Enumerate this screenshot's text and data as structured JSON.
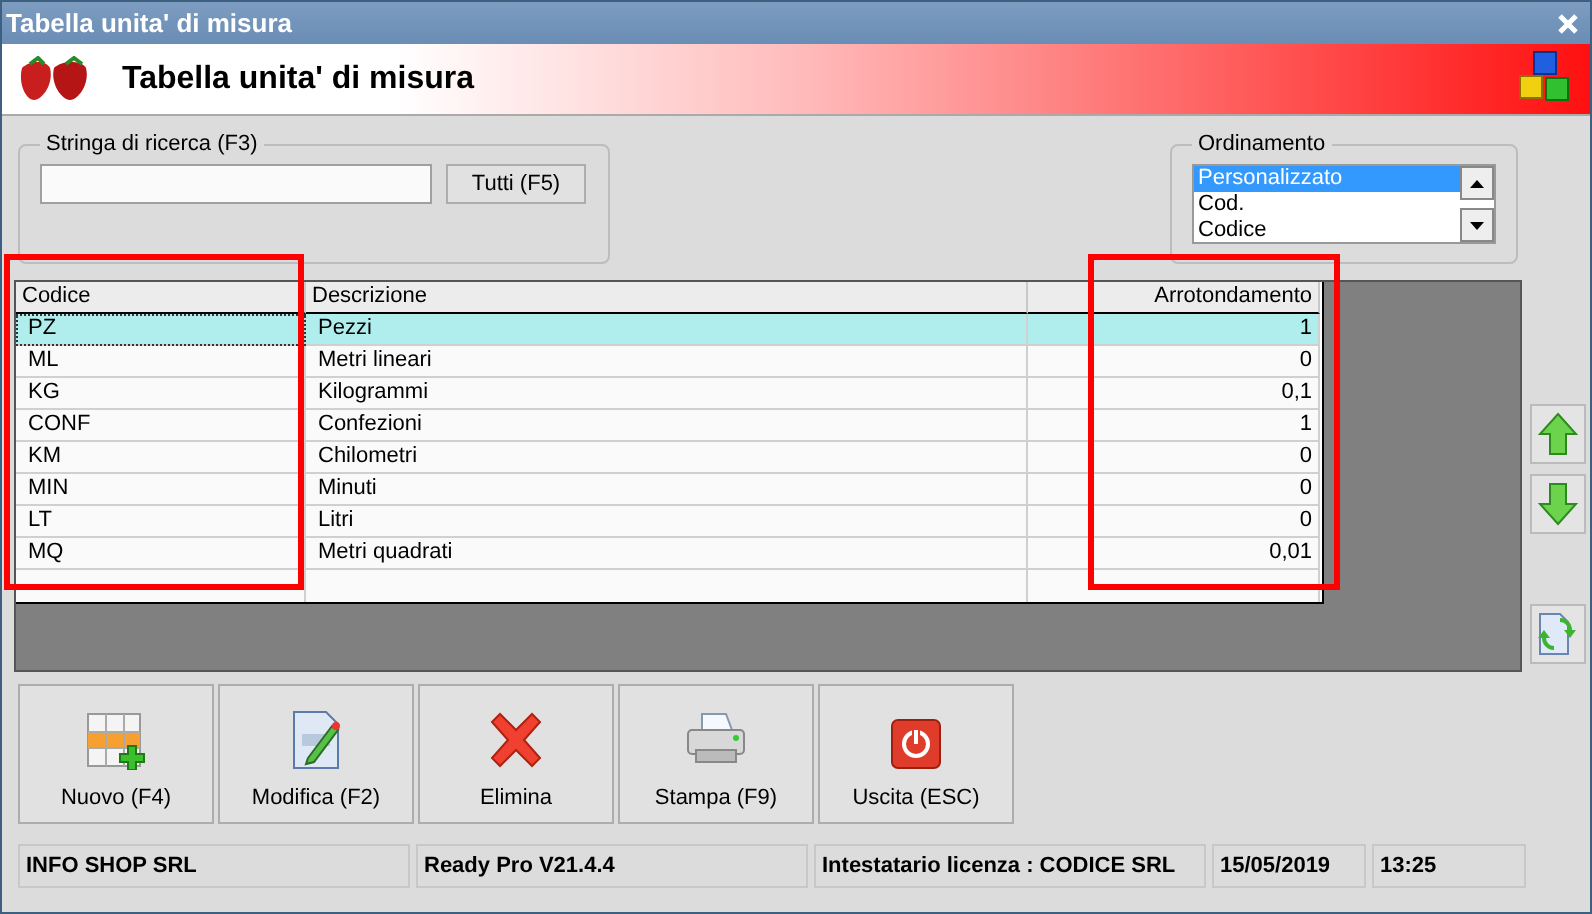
{
  "window": {
    "title": "Tabella unita' di misura"
  },
  "header": {
    "title": "Tabella unita' di misura"
  },
  "search": {
    "label": "Stringa di ricerca (F3)",
    "button": "Tutti (F5)"
  },
  "ordering": {
    "label": "Ordinamento",
    "options": [
      {
        "label": "Personalizzato",
        "selected": true
      },
      {
        "label": "Cod.",
        "selected": false
      },
      {
        "label": "Codice",
        "selected": false
      }
    ]
  },
  "table": {
    "columns": [
      {
        "label": "Codice",
        "kind": "text",
        "highlighted": true
      },
      {
        "label": "Descrizione",
        "kind": "text",
        "highlighted": false
      },
      {
        "label": "Arrotondamento",
        "kind": "number",
        "highlighted": true
      }
    ],
    "rows": [
      {
        "cells": [
          "PZ",
          "Pezzi",
          "1"
        ],
        "selected": true
      },
      {
        "cells": [
          "ML",
          "Metri lineari",
          "0"
        ],
        "selected": false
      },
      {
        "cells": [
          "KG",
          "Kilogrammi",
          "0,1"
        ],
        "selected": false
      },
      {
        "cells": [
          "CONF",
          "Confezioni",
          "1"
        ],
        "selected": false
      },
      {
        "cells": [
          "KM",
          "Chilometri",
          "0"
        ],
        "selected": false
      },
      {
        "cells": [
          "MIN",
          "Minuti",
          "0"
        ],
        "selected": false
      },
      {
        "cells": [
          "LT",
          "Litri",
          "0"
        ],
        "selected": false
      },
      {
        "cells": [
          "MQ",
          "Metri quadrati",
          "0,01"
        ],
        "selected": false
      }
    ]
  },
  "toolbar": [
    {
      "label": "Nuovo (F4)",
      "kind": "new"
    },
    {
      "label": "Modifica (F2)",
      "kind": "edit"
    },
    {
      "label": "Elimina",
      "kind": "delete"
    },
    {
      "label": "Stampa (F9)",
      "kind": "print"
    },
    {
      "label": "Uscita (ESC)",
      "kind": "exit"
    }
  ],
  "status_bar": [
    "INFO SHOP SRL",
    "Ready Pro V21.4.4",
    "Intestatario licenza : CODICE SRL",
    "15/05/2019",
    "13:25"
  ]
}
